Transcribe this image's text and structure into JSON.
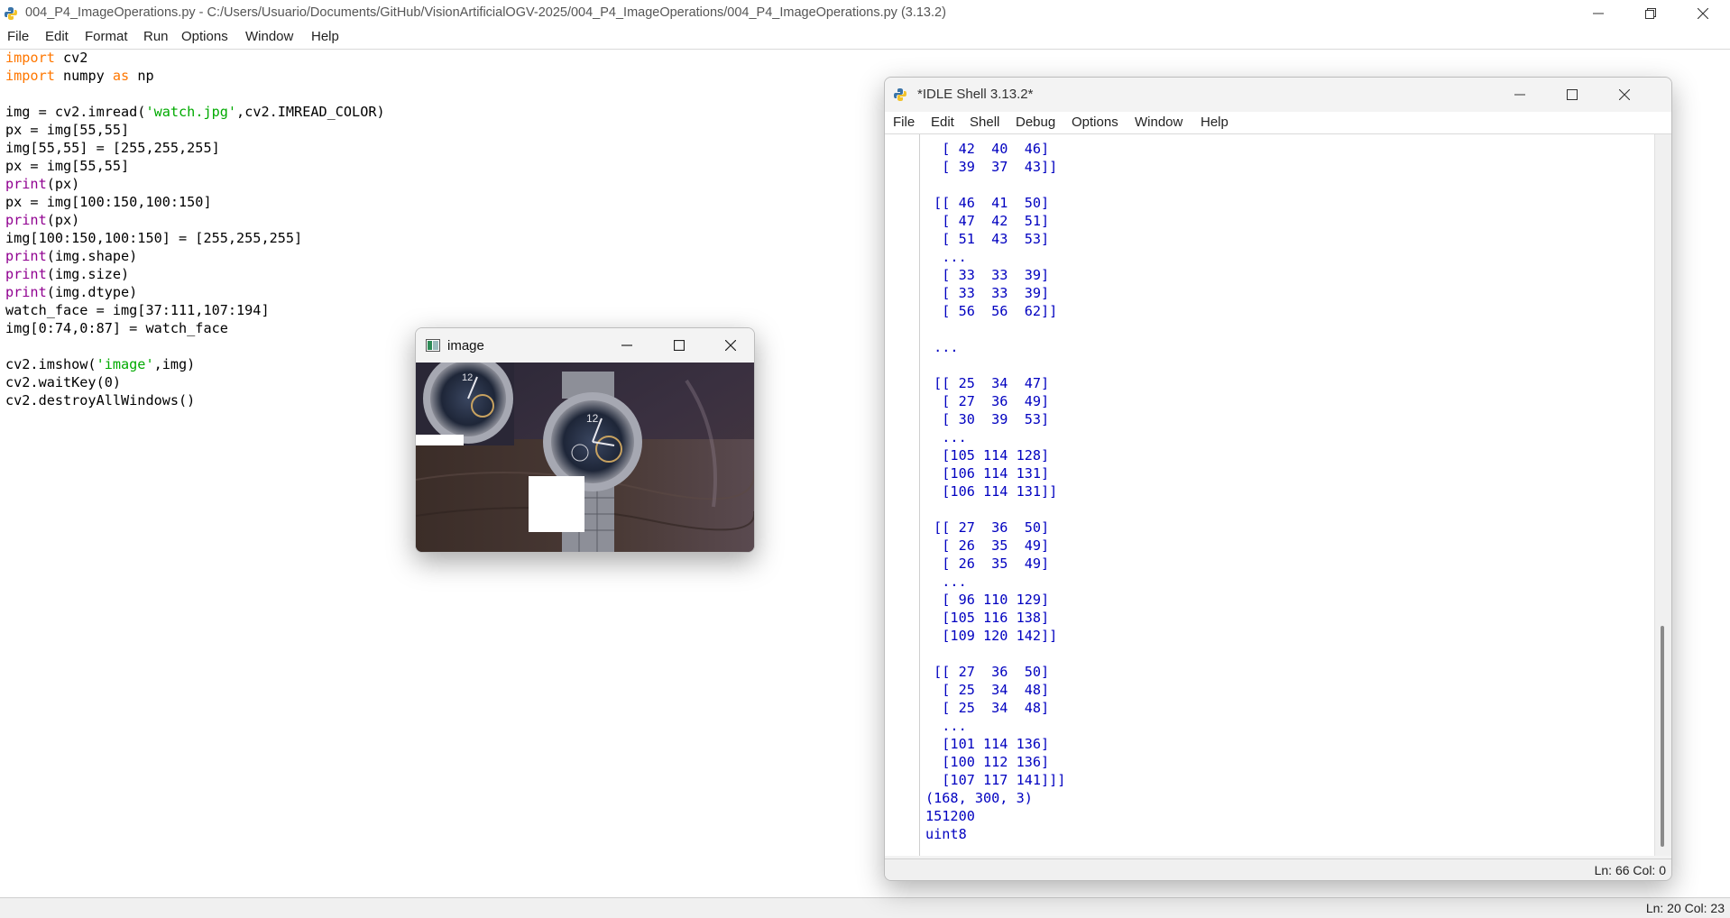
{
  "editor_window": {
    "title": "004_P4_ImageOperations.py - C:/Users/Usuario/Documents/GitHub/VisionArtificialOGV-2025/004_P4_ImageOperations/004_P4_ImageOperations.py (3.13.2)",
    "menu": [
      "File",
      "Edit",
      "Format",
      "Run",
      "Options",
      "Window",
      "Help"
    ],
    "code": [
      [
        [
          "kw",
          "import"
        ],
        [
          "n",
          " cv2"
        ]
      ],
      [
        [
          "kw",
          "import"
        ],
        [
          "n",
          " numpy "
        ],
        [
          "kw",
          "as"
        ],
        [
          "n",
          " np"
        ]
      ],
      [],
      [
        [
          "n",
          "img = cv2.imread("
        ],
        [
          "str",
          "'watch.jpg'"
        ],
        [
          "n",
          ",cv2.IMREAD_COLOR)"
        ]
      ],
      [
        [
          "n",
          "px = img[55,55]"
        ]
      ],
      [
        [
          "n",
          "img[55,55] = [255,255,255]"
        ]
      ],
      [
        [
          "n",
          "px = img[55,55]"
        ]
      ],
      [
        [
          "bi",
          "print"
        ],
        [
          "n",
          "(px)"
        ]
      ],
      [
        [
          "n",
          "px = img[100:150,100:150]"
        ]
      ],
      [
        [
          "bi",
          "print"
        ],
        [
          "n",
          "(px)"
        ]
      ],
      [
        [
          "n",
          "img[100:150,100:150] = [255,255,255]"
        ]
      ],
      [
        [
          "bi",
          "print"
        ],
        [
          "n",
          "(img.shape)"
        ]
      ],
      [
        [
          "bi",
          "print"
        ],
        [
          "n",
          "(img.size)"
        ]
      ],
      [
        [
          "bi",
          "print"
        ],
        [
          "n",
          "(img.dtype)"
        ]
      ],
      [
        [
          "n",
          "watch_face = img[37:111,107:194]"
        ]
      ],
      [
        [
          "n",
          "img[0:74,0:87] = watch_face"
        ]
      ],
      [],
      [
        [
          "n",
          "cv2.imshow("
        ],
        [
          "str",
          "'image'"
        ],
        [
          "n",
          ",img)"
        ]
      ],
      [
        [
          "n",
          "cv2.waitKey(0)"
        ]
      ],
      [
        [
          "n",
          "cv2.destroyAllWindows()"
        ]
      ]
    ],
    "status": "Ln: 20   Col: 23"
  },
  "image_window": {
    "title": "image"
  },
  "shell_window": {
    "title": "*IDLE Shell 3.13.2*",
    "menu": [
      "File",
      "Edit",
      "Shell",
      "Debug",
      "Options",
      "Window",
      "Help"
    ],
    "output": [
      "  [ 42  40  46]",
      "  [ 39  37  43]]",
      "",
      " [[ 46  41  50]",
      "  [ 47  42  51]",
      "  [ 51  43  53]",
      "  ...",
      "  [ 33  33  39]",
      "  [ 33  33  39]",
      "  [ 56  56  62]]",
      "",
      " ...",
      "",
      " [[ 25  34  47]",
      "  [ 27  36  49]",
      "  [ 30  39  53]",
      "  ...",
      "  [105 114 128]",
      "  [106 114 131]",
      "  [106 114 131]]",
      "",
      " [[ 27  36  50]",
      "  [ 26  35  49]",
      "  [ 26  35  49]",
      "  ...",
      "  [ 96 110 129]",
      "  [105 116 138]",
      "  [109 120 142]]",
      "",
      " [[ 27  36  50]",
      "  [ 25  34  48]",
      "  [ 25  34  48]",
      "  ...",
      "  [101 114 136]",
      "  [100 112 136]",
      "  [107 117 141]]]",
      "(168, 300, 3)",
      "151200",
      "uint8"
    ],
    "status": "Ln: 66   Col: 0"
  },
  "colors": {
    "keyword": "#ff7700",
    "builtin": "#900090",
    "string": "#00aa00",
    "shell_output": "#0000c0"
  }
}
